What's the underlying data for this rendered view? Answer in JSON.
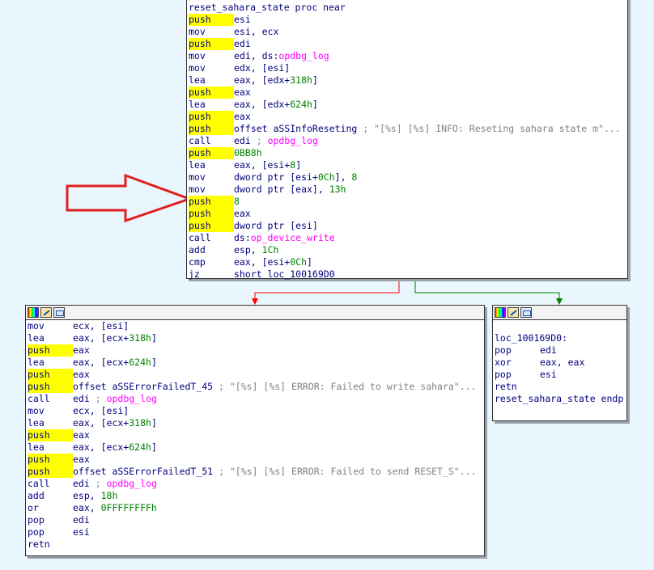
{
  "top_block": {
    "lines": [
      {
        "label": "reset_sahara_state proc near"
      },
      {
        "mnemonic": "push",
        "operand": "esi"
      },
      {
        "mnemonic": "mov",
        "operand": "esi, ecx"
      },
      {
        "mnemonic": "push",
        "operand": "edi"
      },
      {
        "mnemonic": "mov",
        "parts": [
          [
            "op",
            "edi, ds:"
          ],
          [
            "fn",
            "opdbg_log"
          ]
        ]
      },
      {
        "mnemonic": "mov",
        "operand": "edx, [esi]"
      },
      {
        "mnemonic": "lea",
        "parts": [
          [
            "op",
            "eax, [edx+"
          ],
          [
            "num",
            "318h"
          ],
          [
            "op",
            "]"
          ]
        ]
      },
      {
        "mnemonic": "push",
        "operand": "eax"
      },
      {
        "mnemonic": "lea",
        "parts": [
          [
            "op",
            "eax, [edx+"
          ],
          [
            "num",
            "624h"
          ],
          [
            "op",
            "]"
          ]
        ]
      },
      {
        "mnemonic": "push",
        "operand": "eax"
      },
      {
        "mnemonic": "push",
        "parts": [
          [
            "op",
            "offset aSSInfoReseting "
          ],
          [
            "cmt",
            "; \"[%s] [%s] INFO: Reseting sahara state m\"..."
          ]
        ]
      },
      {
        "mnemonic": "call",
        "parts": [
          [
            "op",
            "edi "
          ],
          [
            "cmt",
            "; "
          ],
          [
            "fn",
            "opdbg_log"
          ]
        ]
      },
      {
        "mnemonic": "push",
        "parts": [
          [
            "num",
            "0BB8h"
          ]
        ]
      },
      {
        "mnemonic": "lea",
        "parts": [
          [
            "op",
            "eax, [esi+"
          ],
          [
            "num",
            "8"
          ],
          [
            "op",
            "]"
          ]
        ]
      },
      {
        "mnemonic": "mov",
        "parts": [
          [
            "op",
            "dword ptr [esi+"
          ],
          [
            "num",
            "0Ch"
          ],
          [
            "op",
            "], "
          ],
          [
            "num",
            "8"
          ]
        ]
      },
      {
        "mnemonic": "mov",
        "parts": [
          [
            "op",
            "dword ptr [eax], "
          ],
          [
            "num",
            "13h"
          ]
        ]
      },
      {
        "mnemonic": "push",
        "parts": [
          [
            "num",
            "8"
          ]
        ]
      },
      {
        "mnemonic": "push",
        "operand": "eax"
      },
      {
        "mnemonic": "push",
        "operand": "dword ptr [esi]"
      },
      {
        "mnemonic": "call",
        "parts": [
          [
            "op",
            "ds:"
          ],
          [
            "fn",
            "op_device_write"
          ]
        ]
      },
      {
        "mnemonic": "add",
        "parts": [
          [
            "op",
            "esp, "
          ],
          [
            "num",
            "1Ch"
          ]
        ]
      },
      {
        "mnemonic": "cmp",
        "parts": [
          [
            "op",
            "eax, [esi+"
          ],
          [
            "num",
            "0Ch"
          ],
          [
            "op",
            "]"
          ]
        ]
      },
      {
        "mnemonic": "jz",
        "operand": "short loc_100169D0"
      }
    ]
  },
  "left_block": {
    "lines": [
      {
        "mnemonic": "mov",
        "operand": "ecx, [esi]"
      },
      {
        "mnemonic": "lea",
        "parts": [
          [
            "op",
            "eax, [ecx+"
          ],
          [
            "num",
            "318h"
          ],
          [
            "op",
            "]"
          ]
        ]
      },
      {
        "mnemonic": "push",
        "operand": "eax"
      },
      {
        "mnemonic": "lea",
        "parts": [
          [
            "op",
            "eax, [ecx+"
          ],
          [
            "num",
            "624h"
          ],
          [
            "op",
            "]"
          ]
        ]
      },
      {
        "mnemonic": "push",
        "operand": "eax"
      },
      {
        "mnemonic": "push",
        "parts": [
          [
            "op",
            "offset aSSErrorFailedT_45 "
          ],
          [
            "cmt",
            "; \"[%s] [%s] ERROR: Failed to write sahara\"..."
          ]
        ]
      },
      {
        "mnemonic": "call",
        "parts": [
          [
            "op",
            "edi "
          ],
          [
            "cmt",
            "; "
          ],
          [
            "fn",
            "opdbg_log"
          ]
        ]
      },
      {
        "mnemonic": "mov",
        "operand": "ecx, [esi]"
      },
      {
        "mnemonic": "lea",
        "parts": [
          [
            "op",
            "eax, [ecx+"
          ],
          [
            "num",
            "318h"
          ],
          [
            "op",
            "]"
          ]
        ]
      },
      {
        "mnemonic": "push",
        "operand": "eax"
      },
      {
        "mnemonic": "lea",
        "parts": [
          [
            "op",
            "eax, [ecx+"
          ],
          [
            "num",
            "624h"
          ],
          [
            "op",
            "]"
          ]
        ]
      },
      {
        "mnemonic": "push",
        "operand": "eax"
      },
      {
        "mnemonic": "push",
        "parts": [
          [
            "op",
            "offset aSSErrorFailedT_51 "
          ],
          [
            "cmt",
            "; \"[%s] [%s] ERROR: Failed to send RESET_S\"..."
          ]
        ]
      },
      {
        "mnemonic": "call",
        "parts": [
          [
            "op",
            "edi "
          ],
          [
            "cmt",
            "; "
          ],
          [
            "fn",
            "opdbg_log"
          ]
        ]
      },
      {
        "mnemonic": "add",
        "parts": [
          [
            "op",
            "esp, "
          ],
          [
            "num",
            "18h"
          ]
        ]
      },
      {
        "mnemonic": "or",
        "parts": [
          [
            "op",
            "eax, "
          ],
          [
            "num",
            "0FFFFFFFFh"
          ]
        ]
      },
      {
        "mnemonic": "pop",
        "operand": "edi"
      },
      {
        "mnemonic": "pop",
        "operand": "esi"
      },
      {
        "mnemonic": "retn",
        "operand": ""
      }
    ]
  },
  "right_block": {
    "lines": [
      {
        "blank": true
      },
      {
        "label": "loc_100169D0:"
      },
      {
        "mnemonic": "pop",
        "operand": "edi"
      },
      {
        "mnemonic": "xor",
        "operand": "eax, eax"
      },
      {
        "mnemonic": "pop",
        "operand": "esi"
      },
      {
        "mnemonic": "retn",
        "operand": ""
      },
      {
        "label": "reset_sahara_state endp"
      }
    ]
  },
  "colors": {
    "background": "#eaf6fd",
    "push_highlight": "#ffff00",
    "false_edge": "#ff0000",
    "true_edge": "#008000",
    "annotation_arrow": "#e02020"
  },
  "icons": [
    "color-palette-icon",
    "edit-pencil-icon",
    "graph-overview-icon"
  ]
}
